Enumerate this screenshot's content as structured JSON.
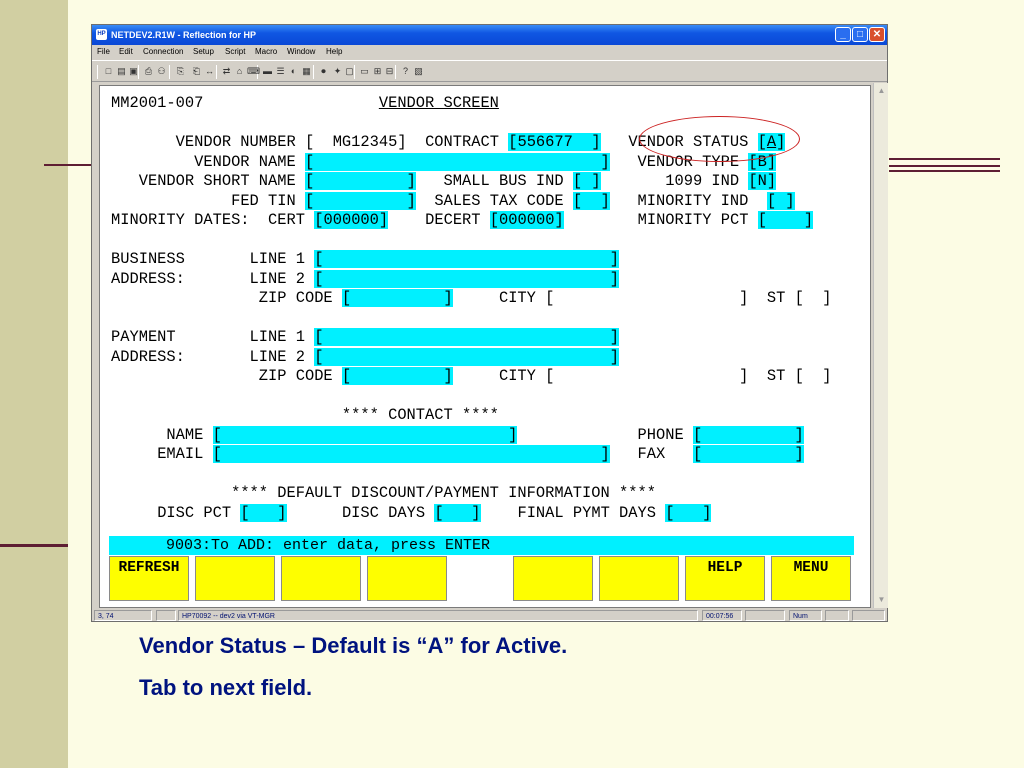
{
  "window": {
    "title": "NETDEV2.R1W - Reflection for HP",
    "app_icon": "HP",
    "buttons": {
      "minimize": "_",
      "maximize": "□",
      "close": "✕"
    }
  },
  "menu": [
    "File",
    "Edit",
    "Connection",
    "Setup",
    "Script",
    "Macro",
    "Window",
    "Help"
  ],
  "toolbar_icons": [
    {
      "name": "new-icon",
      "glyph": "□"
    },
    {
      "name": "open-icon",
      "glyph": "▤"
    },
    {
      "name": "save-icon",
      "glyph": "▣"
    },
    {
      "name": "print-icon",
      "glyph": "⎙"
    },
    {
      "name": "find-icon",
      "glyph": "⚇"
    },
    {
      "name": "copy-icon",
      "glyph": "⎘"
    },
    {
      "name": "paste-icon",
      "glyph": "⎗"
    },
    {
      "name": "connect-icon",
      "glyph": "↔"
    },
    {
      "name": "transfer-icon",
      "glyph": "⇄"
    },
    {
      "name": "host-icon",
      "glyph": "⌂"
    },
    {
      "name": "keyboard-icon",
      "glyph": "⌨"
    },
    {
      "name": "display-icon",
      "glyph": "▬"
    },
    {
      "name": "settings-icon",
      "glyph": "☰"
    },
    {
      "name": "color-icon",
      "glyph": "◐"
    },
    {
      "name": "screen-icon",
      "glyph": "▦"
    },
    {
      "name": "record-icon",
      "glyph": "⏺"
    },
    {
      "name": "macro-icon",
      "glyph": "✦"
    },
    {
      "name": "window-icon",
      "glyph": "▢"
    },
    {
      "name": "terminal-icon",
      "glyph": "▭"
    },
    {
      "name": "grid-icon",
      "glyph": "⊞"
    },
    {
      "name": "dialog-icon",
      "glyph": "⊟"
    },
    {
      "name": "help-icon",
      "glyph": "?"
    },
    {
      "name": "book-icon",
      "glyph": "▧"
    }
  ],
  "screen": {
    "form_id": "MM2001-007",
    "title": "VENDOR SCREEN",
    "vendor_number_label": "VENDOR NUMBER",
    "vendor_number": "MG12345",
    "contract_label": "CONTRACT",
    "contract": "556677",
    "vendor_status_label": "VENDOR STATUS",
    "vendor_status": "A",
    "vendor_name_label": "VENDOR NAME",
    "vendor_type_label": "VENDOR TYPE",
    "vendor_type": "B",
    "vendor_short_name_label": "VENDOR SHORT NAME",
    "small_bus_ind_label": "SMALL BUS IND",
    "ind_1099_label": "1099 IND",
    "ind_1099": "N",
    "fed_tin_label": "FED TIN",
    "sales_tax_code_label": "SALES TAX CODE",
    "minority_ind_label": "MINORITY IND",
    "minority_dates_label": "MINORITY DATES:",
    "cert_label": "CERT",
    "cert": "000000",
    "decert_label": "DECERT",
    "decert": "000000",
    "minority_pct_label": "MINORITY PCT",
    "business_label": "BUSINESS",
    "address_label": "ADDRESS:",
    "line1_label": "LINE 1",
    "line2_label": "LINE 2",
    "zip_label": "ZIP CODE",
    "city_label": "CITY",
    "st_label": "ST",
    "payment_label": "PAYMENT",
    "contact_header": "**** CONTACT ****",
    "name_label": "NAME",
    "phone_label": "PHONE",
    "email_label": "EMAIL",
    "fax_label": "FAX",
    "discount_header": "**** DEFAULT DISCOUNT/PAYMENT INFORMATION ****",
    "disc_pct_label": "DISC PCT",
    "disc_days_label": "DISC DAYS",
    "final_pymt_days_label": "FINAL PYMT DAYS",
    "message": "9003:To ADD: enter data, press ENTER"
  },
  "function_keys": [
    "REFRESH",
    "",
    "",
    "",
    "",
    "",
    "",
    "HELP",
    "MENU"
  ],
  "statusbar": {
    "cursor": "3, 74",
    "host": "HP70092 -- dev2 via VT-MGR",
    "time": "00:07:56",
    "num": "Num"
  },
  "caption": {
    "line1": "Vendor Status – Default is “A” for Active.",
    "line2": "Tab to next field."
  },
  "colors": {
    "field_bg": "#00f0ff",
    "fkey_bg": "#fefe00",
    "annotation_circle": "#cc2222",
    "caption_text": "#00137f",
    "slide_bg": "#fcfce4",
    "slide_sidebar": "#d1cfa2",
    "slide_accent_line": "#5e1e33"
  }
}
